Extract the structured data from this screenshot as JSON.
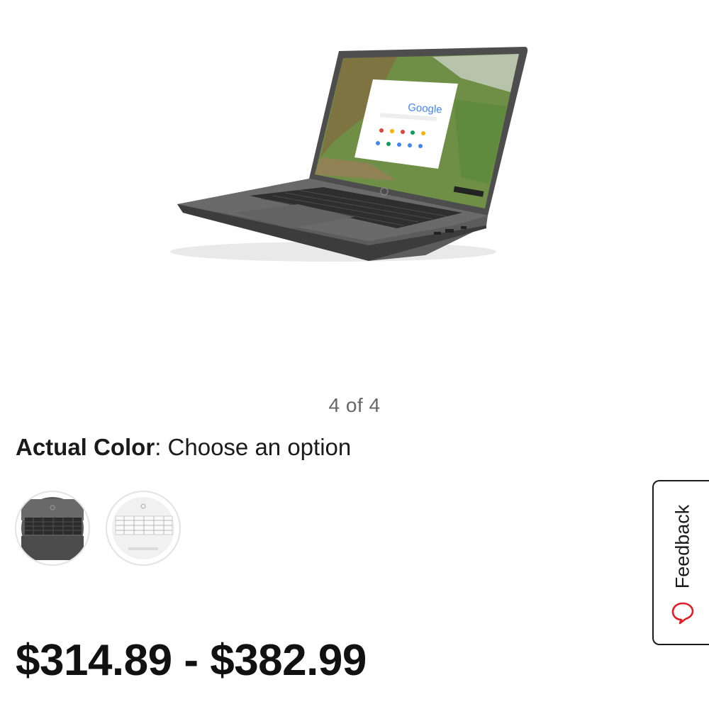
{
  "gallery": {
    "counter": "4 of 4",
    "product_image": "laptop-chromebook-image",
    "screen_logo_text": "Google"
  },
  "color_selector": {
    "label": "Actual Color",
    "separator": ":",
    "value": "Choose an option",
    "options": [
      {
        "name": "dark-gray-swatch",
        "color": "#555555"
      },
      {
        "name": "white-swatch",
        "color": "#f2f2f2"
      }
    ]
  },
  "pricing": {
    "range": "$314.89 - $382.99"
  },
  "feedback": {
    "label": "Feedback",
    "icon": "chat-bubble-icon",
    "icon_color": "#e31b23"
  }
}
